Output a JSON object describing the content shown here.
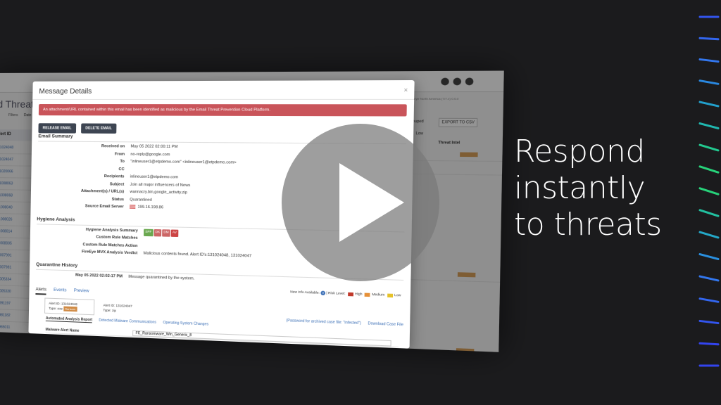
{
  "headline": {
    "line1": "Respond",
    "line2": "instantly",
    "line3": "to threats"
  },
  "background_app": {
    "page_title": "d Threat",
    "column_header": "Alert ID",
    "filters_label": "Filters",
    "filter_value": "Date",
    "alert_ids": [
      "131024048",
      "131024047",
      "131020066",
      "131008063",
      "131008068",
      "131008040",
      "131008026",
      "131008014",
      "131008005",
      "131007991",
      "131007981",
      "131005334",
      "131005330",
      "130991197",
      "130981182",
      "130965011",
      "130961010",
      "130956913"
    ],
    "export_button": "EXPORT TO CSV",
    "grouped_label": "Grouped",
    "threat_intel_header": "Threat Intel",
    "low_label": "Low",
    "tag_label": "Ransom",
    "region_text": "right: Fireeye North America (7/7.x) 0.0.0"
  },
  "modal": {
    "title": "Message Details",
    "close_icon": "×",
    "alert_text": "An attachment/URL contained within this email has been identified as malicious by the Email Threat Prevention Cloud Platform.",
    "buttons": {
      "release": "RELEASE EMAIL",
      "delete": "DELETE EMAIL"
    },
    "email_summary": {
      "heading": "Email Summary",
      "fields": [
        {
          "k": "Received on",
          "v": "May 05 2022 02:00:11 PM"
        },
        {
          "k": "From",
          "v": "no-reply@google.com"
        },
        {
          "k": "To",
          "v": "\"inlineuser1@etpdemo.com\" <inlineuser1@etpdemo.com>"
        },
        {
          "k": "CC",
          "v": ""
        },
        {
          "k": "Recipients",
          "v": "inlineuser1@etpdemo.com"
        },
        {
          "k": "Subject",
          "v": "Join all major influencers of News"
        },
        {
          "k": "Attachment(s) / URL(s)",
          "v": "wannacry.bin,google_activity.zip"
        },
        {
          "k": "Status",
          "v": "Quarantined"
        },
        {
          "k": "Source Email Server",
          "v": "199.16.198.86"
        }
      ]
    },
    "hygiene": {
      "heading": "Hygiene Analysis",
      "fields": [
        {
          "k": "Hygiene Analysis Summary",
          "v": ""
        },
        {
          "k": "Custom Rule Matches",
          "v": ""
        },
        {
          "k": "Custom Rule Matches Action",
          "v": ""
        },
        {
          "k": "FireEye MVX Analysis Verdict",
          "v": "Malicious contents found. Alert ID's:131024048, 131024047"
        }
      ],
      "pills": [
        {
          "label": "SPF",
          "color": "#6aa84f"
        },
        {
          "label": "DK",
          "color": "#cc6666"
        },
        {
          "label": "DM",
          "color": "#cc6666"
        },
        {
          "label": "AV",
          "color": "#cc4444"
        }
      ]
    },
    "quarantine": {
      "heading": "Quarantine History",
      "date": "May 05 2022 02:02:17 PM",
      "message": "Message quarantined by the system."
    },
    "tabs": [
      "Alerts",
      "Events",
      "Preview"
    ],
    "legend": {
      "new_info": "New Info Available:",
      "risk_level": "| Risk Level:",
      "high": "High",
      "medium": "Medium",
      "low": "Low",
      "colors": {
        "high": "#c0392b",
        "medium": "#e69138",
        "low": "#e6c229"
      }
    },
    "alert_cards": [
      {
        "id": "Alert ID: 131024048",
        "type": "Type: exe",
        "badge": "Ransom"
      },
      {
        "id": "Alert ID: 131024047",
        "type": "Type: zip",
        "badge": ""
      }
    ],
    "password_note": "(Password for archived case file: \"infected\")",
    "download_link": "Download Case File",
    "sub_tabs": [
      "Automated Analysis Report",
      "Detected Malware Communications",
      "Operating System Changes"
    ],
    "report_rows": [
      {
        "k": "Malware Alert Name",
        "v": "FE_Ransomware_Win_Generic_8"
      }
    ]
  },
  "accent_colors": {
    "alert_red": "#c9545a",
    "link_blue": "#3b6fb6",
    "dark_button": "#3d4552"
  }
}
